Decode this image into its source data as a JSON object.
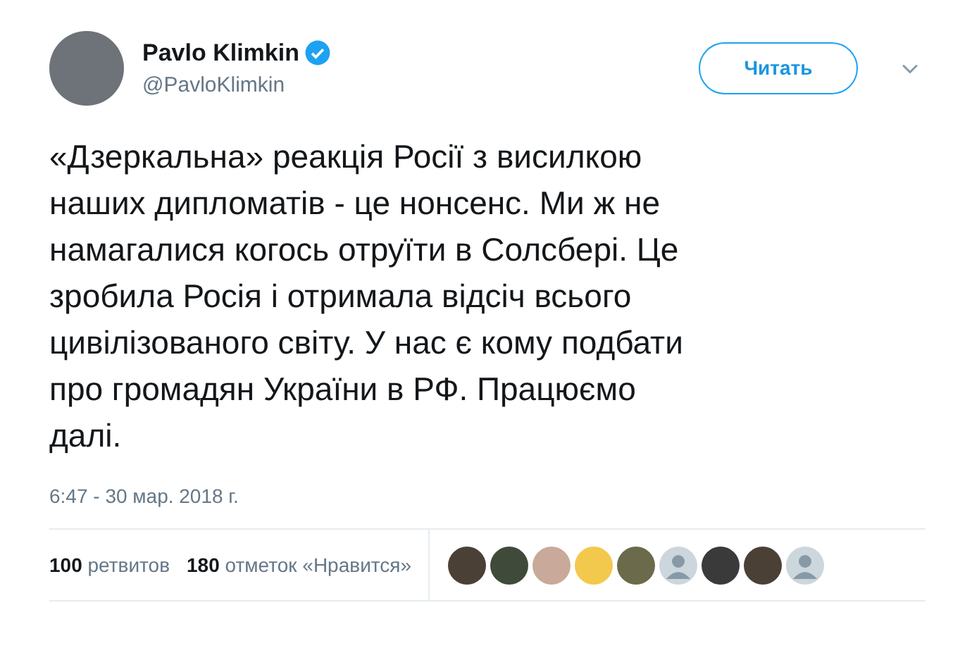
{
  "author": {
    "name": "Pavlo Klimkin",
    "verified": true,
    "handle": "@PavloKlimkin"
  },
  "follow_button": {
    "label": "Читать"
  },
  "tweet_lines": [
    "«Дзеркальна» реакція Росії з висилкою",
    "наших дипломатів - це нонсенс. Ми ж не",
    "намагалися когось отруїти в Солсбері. Це",
    "зробила Росія і отримала відсіч всього",
    "цивілізованого світу. У нас є кому подбати",
    "про громадян України в РФ. Працюємо",
    "далі."
  ],
  "timestamp": "6:47 - 30 мар. 2018 г.",
  "stats": [
    {
      "count": "100",
      "label": "ретвитов"
    },
    {
      "count": "180",
      "label": "отметок «Нравится»"
    }
  ],
  "likers": [
    {
      "kind": "photo"
    },
    {
      "kind": "photo"
    },
    {
      "kind": "photo"
    },
    {
      "kind": "photo"
    },
    {
      "kind": "photo"
    },
    {
      "kind": "default"
    },
    {
      "kind": "photo"
    },
    {
      "kind": "photo"
    },
    {
      "kind": "default"
    }
  ]
}
